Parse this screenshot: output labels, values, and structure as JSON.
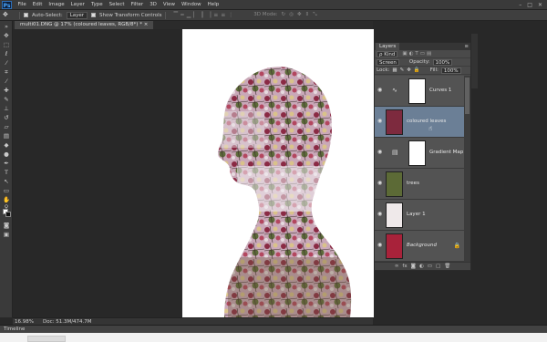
{
  "menubar": {
    "logo": "Ps",
    "items": [
      "File",
      "Edit",
      "Image",
      "Layer",
      "Type",
      "Select",
      "Filter",
      "3D",
      "View",
      "Window",
      "Help"
    ],
    "controls": [
      "–",
      "□",
      "✕"
    ]
  },
  "options": {
    "tool_icon": "move-tool-icon",
    "auto_select_label": "Auto-Select:",
    "auto_select_value": "Layer",
    "show_transform_label": "Show Transform Controls",
    "mode_3d_label": "3D Mode:"
  },
  "document": {
    "tab_title": "multi01.DNG @ 17% (coloured leaves, RGB/8*) * ×"
  },
  "statusbar": {
    "zoom": "16.98%",
    "doc_info": "Doc: 51.3M/474.7M"
  },
  "timeline": {
    "label": "Timeline"
  },
  "layers_panel": {
    "tab": "Layers",
    "filter_kind": "ρ Kind",
    "blend_mode": "Screen",
    "opacity_label": "Opacity:",
    "opacity_value": "100%",
    "lock_label": "Lock:",
    "fill_label": "Fill:",
    "fill_value": "100%",
    "layers": [
      {
        "name": "Curves 1",
        "type": "adjustment",
        "visible": true,
        "selected": false
      },
      {
        "name": "coloured leaves",
        "type": "image",
        "visible": true,
        "selected": true
      },
      {
        "name": "Gradient Map 1",
        "type": "adjustment",
        "visible": true,
        "selected": false
      },
      {
        "name": "trees",
        "type": "image",
        "visible": true,
        "selected": false
      },
      {
        "name": "Layer 1",
        "type": "image",
        "visible": true,
        "selected": false
      },
      {
        "name": "Background",
        "type": "image",
        "visible": true,
        "selected": false,
        "locked": true
      }
    ]
  },
  "colors": {
    "selection": "#6b7f96",
    "panel": "#4a4a4a",
    "canvas_bg": "#282828"
  }
}
